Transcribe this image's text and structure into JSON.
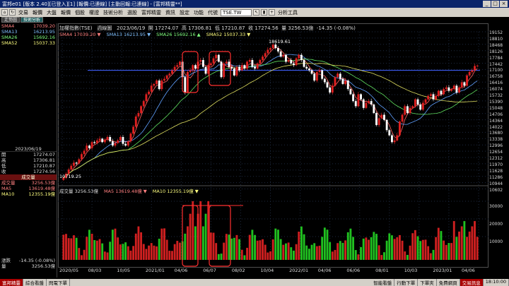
{
  "window": {
    "title": "富邦e01 [版本 2.40][已登入][1] [報價:已連線] [主動回報:已連線] - [富邦精靈**]"
  },
  "menu": {
    "items": [
      "交易",
      "報價",
      "大盤",
      "報價",
      "個股",
      "權證",
      "技術分析",
      "選股",
      "富邦精靈",
      "資訊",
      "設定",
      "功能",
      "代號"
    ],
    "ticker_value": "TSE.TW",
    "analysis_label": "分析工具"
  },
  "tabs": [
    "走勢圖",
    "技術分析"
  ],
  "left_panel": {
    "sma_rows": [
      {
        "label": "SMA4",
        "value": "17039.20",
        "color": "#ff8080"
      },
      {
        "label": "SMA13",
        "value": "16213.95",
        "color": "#80c0ff"
      },
      {
        "label": "SMA26",
        "value": "15692.16",
        "color": "#80ff80"
      },
      {
        "label": "SMA52",
        "value": "15037.33",
        "color": "#ffff80"
      }
    ],
    "date": "2023/06/19",
    "ohlc_rows": [
      {
        "label": "開",
        "value": "17274.07"
      },
      {
        "label": "高",
        "value": "17306.81"
      },
      {
        "label": "低",
        "value": "17210.87"
      },
      {
        "label": "收",
        "value": "17274.56"
      }
    ],
    "volume_header": "成交量",
    "volume_rows": [
      {
        "label": "成交量",
        "value": "3256.53億",
        "color": "#ff8080"
      },
      {
        "label": "MA5",
        "value": "13619.48億",
        "color": "#ff8080"
      },
      {
        "label": "MA10",
        "value": "12355.19億",
        "color": "#ffff80"
      }
    ],
    "change_rows": [
      {
        "label": "漲跌",
        "value": "-14.35 (-0.08%)"
      },
      {
        "label": "量",
        "value": "3256.53億"
      }
    ]
  },
  "chart_header": {
    "name": "加權指數(TSE)",
    "period": "週線圖",
    "date": "2023/06/19",
    "open_label": "開",
    "open": "17274.07",
    "high_label": "高",
    "high": "17306.81",
    "low_label": "低",
    "low": "17210.87",
    "close_label": "收",
    "close": "17274.56",
    "vol_label": "量",
    "vol": "3256.53億",
    "change": "-14.35 (-0.08%)"
  },
  "indicator_legend": [
    {
      "text": "SMA4 17039.20 ▼",
      "color": "#ff8080"
    },
    {
      "text": "SMA13 16213.95 ▼",
      "color": "#80c0ff"
    },
    {
      "text": "SMA26 15692.16 ▲",
      "color": "#80ff80"
    },
    {
      "text": "SMA52 15037.33 ▼",
      "color": "#ffff80"
    }
  ],
  "volume_legend": [
    {
      "text": "成交量 3256.53億",
      "color": "#ddd"
    },
    {
      "text": "MA5 13619.48億 ▼",
      "color": "#ff8080"
    },
    {
      "text": "MA10 12355.19億 ▼",
      "color": "#ffff80"
    }
  ],
  "annotations": {
    "high_label": "18619.61",
    "low_label": "10719.25"
  },
  "price_axis": [
    "19152",
    "18810",
    "18468",
    "18126",
    "17784",
    "17442",
    "17100",
    "16758",
    "16416",
    "16074",
    "15732",
    "15390",
    "15048",
    "14706",
    "14364",
    "14022",
    "13680",
    "13338",
    "12996",
    "12654",
    "12312",
    "11970",
    "11628",
    "11286",
    "10944",
    "10602"
  ],
  "volume_axis": [
    "30000",
    "20000",
    "10000"
  ],
  "x_axis": [
    "2020/05",
    "08/03",
    "10/05",
    "2021/01",
    "04/06",
    "06/07",
    "08/02",
    "10/04",
    "2022/01",
    "04/06",
    "06/06",
    "08/01",
    "10/03",
    "2023/01",
    "04/06"
  ],
  "status": {
    "left": [
      "富邦精靈",
      "綜合看盤",
      "閃電下單"
    ],
    "right": [
      "智能看盤",
      "行動下單",
      "下單夾",
      "免費網頁",
      "交易訊息"
    ],
    "time": "18:10:00"
  },
  "chart_data": {
    "type": "candlestick",
    "closes": [
      10719,
      10950,
      11200,
      11420,
      11600,
      11550,
      11800,
      12100,
      12300,
      12600,
      12450,
      12800,
      12750,
      12900,
      13000,
      12800,
      12950,
      13100,
      12850,
      12600,
      12750,
      12900,
      13100,
      12700,
      12600,
      12850,
      13300,
      13700,
      14300,
      14500,
      14900,
      15200,
      15600,
      15750,
      16100,
      16200,
      16400,
      15900,
      16400,
      16500,
      16700,
      16800,
      17000,
      17200,
      17300,
      17500,
      16600,
      15700,
      16900,
      17000,
      17300,
      17100,
      17500,
      17600,
      17200,
      16800,
      17300,
      17400,
      17700,
      17900,
      17500,
      16600,
      17400,
      17500,
      17200,
      17100,
      16700,
      17200,
      17000,
      17300,
      17100,
      17500,
      17600,
      17200,
      17100,
      17400,
      17600,
      17800,
      18000,
      18200,
      18300,
      18500,
      18300,
      18100,
      17800,
      17900,
      17500,
      17600,
      17400,
      17300,
      17700,
      17900,
      17600,
      17200,
      17100,
      17000,
      16800,
      16400,
      16900,
      17000,
      16500,
      16300,
      16000,
      15700,
      16100,
      16600,
      16800,
      16500,
      16200,
      16400,
      15900,
      15600,
      15200,
      14900,
      15600,
      15300,
      14800,
      15100,
      15200,
      15000,
      14500,
      13800,
      14200,
      14400,
      14100,
      13500,
      13200,
      12800,
      12900,
      13200,
      14000,
      14400,
      14900,
      14500,
      14800,
      14900,
      15300,
      15000,
      14700,
      15100,
      15300,
      15500,
      15600,
      15300,
      15500,
      15800,
      15600,
      15900,
      16000,
      15800,
      15900,
      16100,
      15700,
      16000,
      16300,
      16100,
      16700,
      16900,
      17000,
      17250,
      17274
    ]
  }
}
